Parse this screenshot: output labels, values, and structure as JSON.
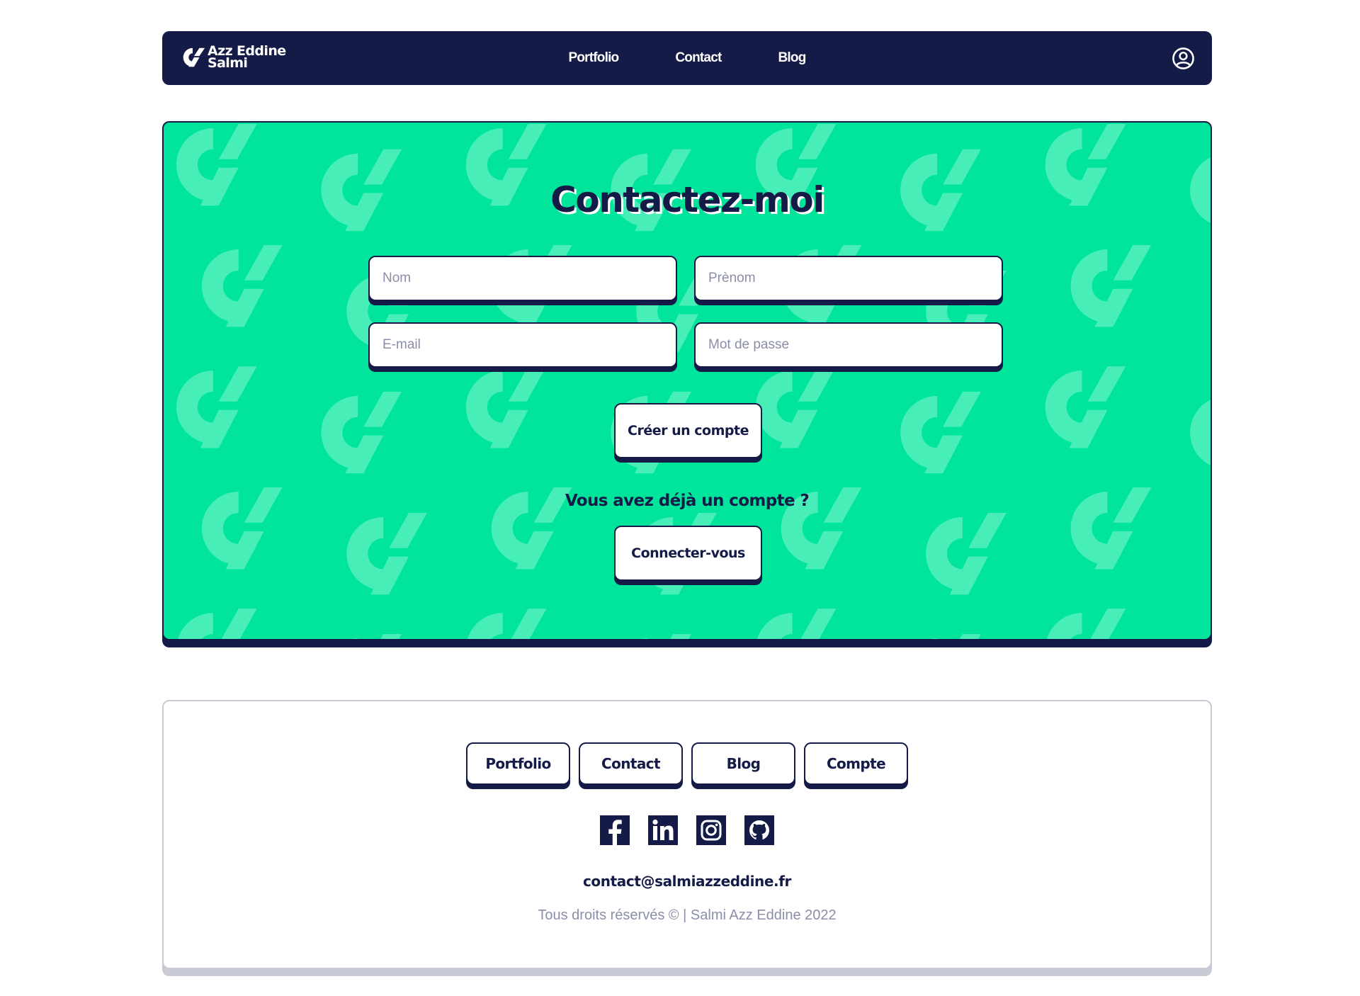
{
  "brand": {
    "name_line1": "Azz Eddine",
    "name_line2": "Salmi",
    "icon": "brand-logo-icon"
  },
  "nav": {
    "links": [
      "Portfolio",
      "Contact",
      "Blog"
    ],
    "account_icon": "user-circle-icon"
  },
  "hero": {
    "title": "Contactez-moi",
    "fields": {
      "nom": {
        "placeholder": "Nom",
        "value": ""
      },
      "prenom": {
        "placeholder": "Prènom",
        "value": ""
      },
      "email": {
        "placeholder": "E-mail",
        "value": ""
      },
      "password": {
        "placeholder": "Mot de passe",
        "value": ""
      }
    },
    "create_account_label": "Créer un compte",
    "question": "Vous avez déjà un compte ?",
    "login_label": "Connecter-vous"
  },
  "footer": {
    "links": [
      "Portfolio",
      "Contact",
      "Blog",
      "Compte"
    ],
    "socials": [
      "facebook-icon",
      "linkedin-icon",
      "instagram-icon",
      "github-icon"
    ],
    "email": "contact@salmiazzeddine.fr",
    "copyright": "Tous droits réservés © | Salmi Azz Eddine 2022"
  },
  "colors": {
    "navy": "#151b47",
    "accent_green": "#00e59b",
    "pattern_green": "#47eeb8",
    "muted": "#8a8ea8",
    "footer_border": "#c8cad6"
  }
}
